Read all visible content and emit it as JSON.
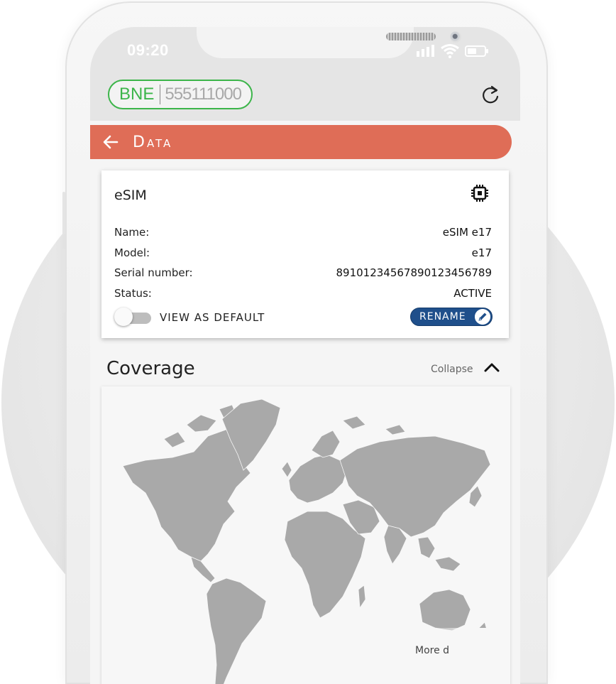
{
  "status_bar": {
    "time": "09:20"
  },
  "carrier": {
    "code": "BNE",
    "number": "555111000"
  },
  "header": {
    "title": "Data"
  },
  "esim_card": {
    "title": "eSIM",
    "rows": [
      {
        "label": "Name:",
        "value": "eSIM e17"
      },
      {
        "label": "Model:",
        "value": "e17"
      },
      {
        "label": "Serial number:",
        "value": "89101234567890123456789"
      },
      {
        "label": "Status:",
        "value": "ACTIVE"
      }
    ],
    "default_toggle": {
      "label": "VIEW AS DEFAULT",
      "on": false
    },
    "rename_label": "RENAME"
  },
  "coverage": {
    "title": "Coverage",
    "collapse_label": "Collapse",
    "more_label": "More d"
  },
  "colors": {
    "accent": "#df6d57",
    "carrier_green": "#3cb54a",
    "button_blue": "#1f4f8b",
    "map_land": "#a9a9a9"
  }
}
